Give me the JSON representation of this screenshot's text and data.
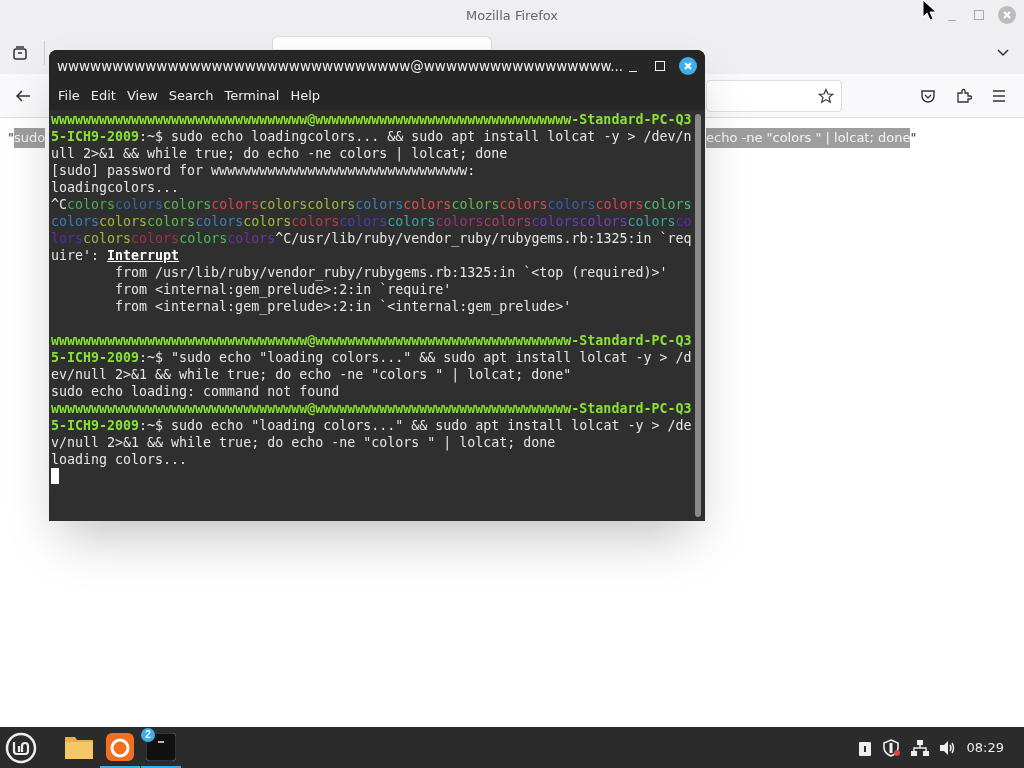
{
  "browser": {
    "title": "Mozilla Firefox"
  },
  "page_text_left": [
    {
      "text": "\"",
      "selected": false
    },
    {
      "text": "sudo",
      "selected": true
    }
  ],
  "page_text_right": [
    {
      "text": "echo -ne \"colors \" | lolcat; done",
      "selected": true
    },
    {
      "text": "\"",
      "selected": false
    }
  ],
  "terminal": {
    "title": "wwwwwwwwwwwwwwwwwwwwwwwwwwwwwwww@wwwwwwwwwwwwwwwww...",
    "menu": [
      "File",
      "Edit",
      "View",
      "Search",
      "Terminal",
      "Help"
    ],
    "cursor_visible": true,
    "rows": [
      {
        "segments": [
          {
            "kind": "prompt",
            "text": "wwwwwwwwwwwwwwwwwwwwwwwwwwwwwwww@wwwwwwwwwwwwwwwwwwwwwwwwwwwwwwww-Standard-PC-Q3"
          }
        ]
      },
      {
        "segments": [
          {
            "kind": "prompt",
            "text": "5-ICH9-2009"
          },
          {
            "kind": "plain",
            "text": ":~$ sudo echo loadingcolors... && sudo apt install lolcat -y > /dev/n"
          }
        ]
      },
      {
        "segments": [
          {
            "kind": "plain",
            "text": "ull 2>&1 && while true; do echo -ne colors | lolcat; done"
          }
        ]
      },
      {
        "segments": [
          {
            "kind": "plain",
            "text": "[sudo] password for wwwwwwwwwwwwwwwwwwwwwwwwwwwwwwww:"
          }
        ]
      },
      {
        "segments": [
          {
            "kind": "plain",
            "text": "loadingcolors..."
          }
        ]
      },
      {
        "segments": [
          {
            "kind": "plain",
            "text": "^C"
          },
          {
            "kind": "rainbow",
            "text": "colors",
            "color": "#4caf50"
          },
          {
            "kind": "rainbow",
            "text": "colors",
            "color": "#3465a4"
          },
          {
            "kind": "rainbow",
            "text": "colors",
            "color": "#55b84a"
          },
          {
            "kind": "rainbow",
            "text": "colors",
            "color": "#d9434e"
          },
          {
            "kind": "rainbow",
            "text": "colors",
            "color": "#a6b43a"
          },
          {
            "kind": "rainbow",
            "text": "colors",
            "color": "#9bbf3a"
          },
          {
            "kind": "rainbow",
            "text": "colors",
            "color": "#3e7fc0"
          },
          {
            "kind": "rainbow",
            "text": "colors",
            "color": "#e0504a"
          },
          {
            "kind": "rainbow",
            "text": "colors",
            "color": "#5cbf4a"
          },
          {
            "kind": "rainbow",
            "text": "colors",
            "color": "#d94a4a"
          },
          {
            "kind": "rainbow",
            "text": "colors",
            "color": "#3a5fb0"
          },
          {
            "kind": "rainbow",
            "text": "colors",
            "color": "#d9434e"
          },
          {
            "kind": "rainbow",
            "text": "colors",
            "color": "#4fbf6a"
          }
        ]
      },
      {
        "segments": [
          {
            "kind": "rainbow",
            "text": "colors",
            "color": "#3b7bbf"
          },
          {
            "kind": "rainbow",
            "text": "colors",
            "color": "#a3b83a"
          },
          {
            "kind": "rainbow",
            "text": "colors",
            "color": "#58bf4a"
          },
          {
            "kind": "rainbow",
            "text": "colors",
            "color": "#3b80c0"
          },
          {
            "kind": "rainbow",
            "text": "colors",
            "color": "#9fc03a"
          },
          {
            "kind": "rainbow",
            "text": "colors",
            "color": "#c0364a"
          },
          {
            "kind": "rainbow",
            "text": "colors",
            "color": "#4a3ab8"
          },
          {
            "kind": "rainbow",
            "text": "colors",
            "color": "#3aa8a0"
          },
          {
            "kind": "rainbow",
            "text": "colors",
            "color": "#a0307a"
          },
          {
            "kind": "rainbow",
            "text": "colors",
            "color": "#b83a6a"
          },
          {
            "kind": "rainbow",
            "text": "colors",
            "color": "#6a3ab8"
          },
          {
            "kind": "rainbow",
            "text": "colors",
            "color": "#7a3ac0"
          },
          {
            "kind": "rainbow",
            "text": "colors",
            "color": "#3aa8a0"
          },
          {
            "kind": "rainbow",
            "text": "co",
            "color": "#5a2ab0"
          }
        ]
      },
      {
        "segments": [
          {
            "kind": "rainbow",
            "text": "lors",
            "color": "#5a2ab0"
          },
          {
            "kind": "rainbow",
            "text": "colors",
            "color": "#a0b83a"
          },
          {
            "kind": "rainbow",
            "text": "colors",
            "color": "#a03050"
          },
          {
            "kind": "rainbow",
            "text": "colors",
            "color": "#4abf5a"
          },
          {
            "kind": "rainbow",
            "text": "colors",
            "color": "#7030a0"
          },
          {
            "kind": "plain",
            "text": "^C/usr/lib/ruby/vendor_ruby/rubygems.rb:1325:in `req"
          }
        ]
      },
      {
        "segments": [
          {
            "kind": "plain",
            "text": "uire': "
          },
          {
            "kind": "strong",
            "text": "Interrupt"
          }
        ]
      },
      {
        "segments": [
          {
            "kind": "plain",
            "text": "        from /usr/lib/ruby/vendor_ruby/rubygems.rb:1325:in `<top (required)>'"
          }
        ]
      },
      {
        "segments": [
          {
            "kind": "plain",
            "text": "        from <internal:gem_prelude>:2:in `require'"
          }
        ]
      },
      {
        "segments": [
          {
            "kind": "plain",
            "text": "        from <internal:gem_prelude>:2:in `<internal:gem_prelude>'"
          }
        ]
      },
      {
        "blank_before": true,
        "segments": [
          {
            "kind": "prompt",
            "text": "wwwwwwwwwwwwwwwwwwwwwwwwwwwwwwww@wwwwwwwwwwwwwwwwwwwwwwwwwwwwwwww-Standard-PC-Q3"
          }
        ]
      },
      {
        "segments": [
          {
            "kind": "prompt",
            "text": "5-ICH9-2009"
          },
          {
            "kind": "plain",
            "text": ":~$ \"sudo echo \"loading colors...\" && sudo apt install lolcat -y > /d"
          }
        ]
      },
      {
        "segments": [
          {
            "kind": "plain",
            "text": "ev/null 2>&1 && while true; do echo -ne \"colors \" | lolcat; done\""
          }
        ]
      },
      {
        "segments": [
          {
            "kind": "plain",
            "text": "sudo echo loading: command not found"
          }
        ]
      },
      {
        "segments": [
          {
            "kind": "prompt",
            "text": "wwwwwwwwwwwwwwwwwwwwwwwwwwwwwwww@wwwwwwwwwwwwwwwwwwwwwwwwwwwwwwww-Standard-PC-Q3"
          }
        ]
      },
      {
        "segments": [
          {
            "kind": "prompt",
            "text": "5-ICH9-2009"
          },
          {
            "kind": "plain",
            "text": ":~$ sudo echo \"loading colors...\" && sudo apt install lolcat -y > /de"
          }
        ]
      },
      {
        "segments": [
          {
            "kind": "plain",
            "text": "v/null 2>&1 && while true; do echo -ne \"colors \" | lolcat; done"
          }
        ]
      },
      {
        "segments": [
          {
            "kind": "plain",
            "text": "loading colors..."
          }
        ]
      }
    ]
  },
  "taskbar": {
    "apps": [
      {
        "kind": "files",
        "selected": false
      },
      {
        "kind": "firefox",
        "selected": true
      },
      {
        "kind": "terminal",
        "selected": true,
        "badge": "2"
      }
    ],
    "clock": "08:29"
  }
}
